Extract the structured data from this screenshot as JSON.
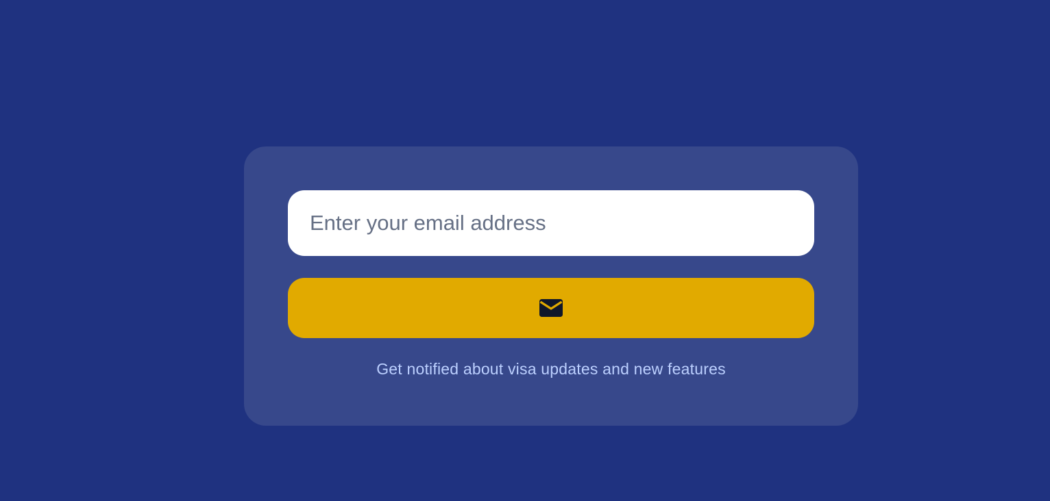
{
  "signup": {
    "email_placeholder": "Enter your email address",
    "email_value": "",
    "button_icon": "mail-icon",
    "caption": "Get notified about visa updates and new features"
  },
  "colors": {
    "background": "#1f3280",
    "card": "#37488b",
    "button": "#e1aa00",
    "caption_text": "#bcd0ff",
    "icon": "#0f172a"
  }
}
